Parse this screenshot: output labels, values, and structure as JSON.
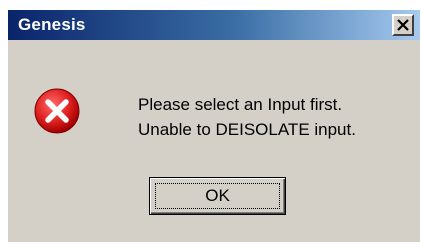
{
  "window": {
    "title": "Genesis",
    "close_glyph": "X"
  },
  "message": {
    "line1": "Please select an Input first.",
    "line2": "Unable to DEISOLATE input."
  },
  "buttons": {
    "ok_label": "OK"
  },
  "icons": {
    "error": "error-x-icon",
    "close": "close-icon"
  },
  "colors": {
    "title_start": "#0a246a",
    "title_end": "#a6caf0",
    "dialog_bg": "#d4d0c8",
    "error_red": "#e02020"
  }
}
